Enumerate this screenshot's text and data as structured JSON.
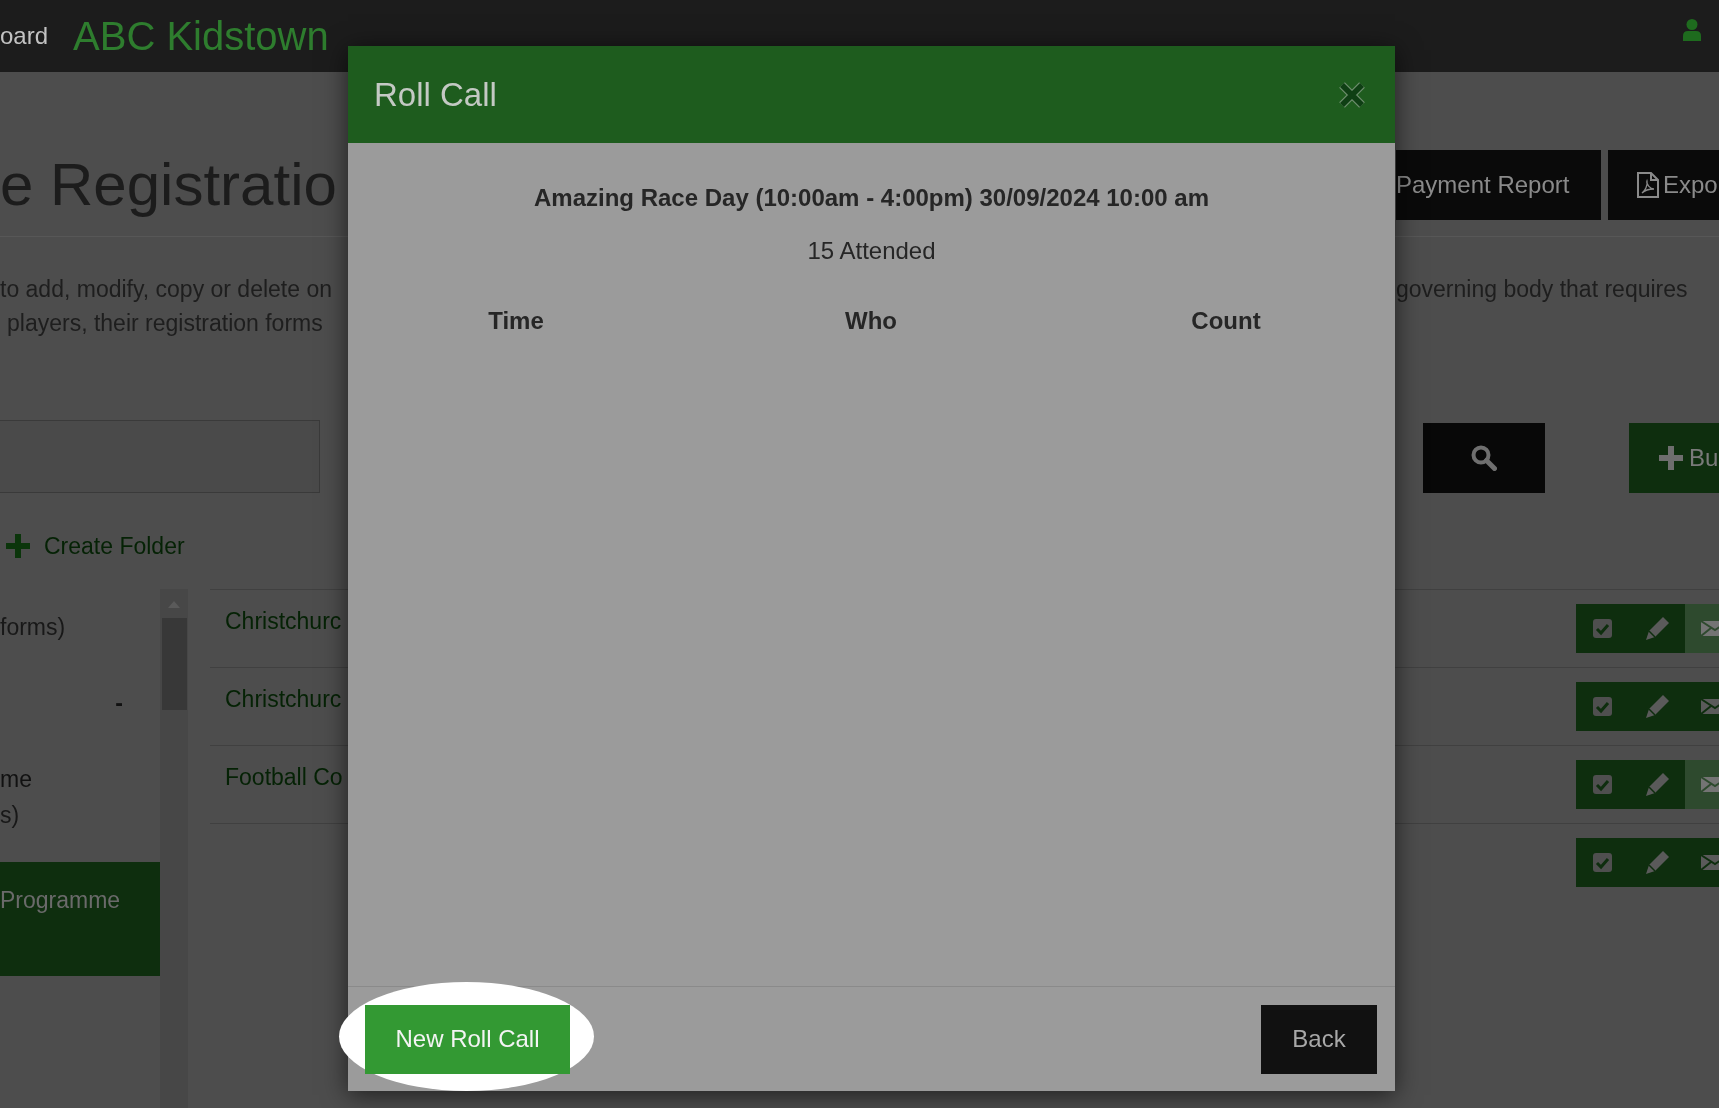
{
  "top_bar": {
    "nav_link": "oard",
    "brand": "ABC Kidstown"
  },
  "page": {
    "title": "e Registratio",
    "header_buttons": [
      {
        "label": "Payment Report",
        "kind": "report"
      },
      {
        "label": "Expo",
        "kind": "export"
      }
    ],
    "description": {
      "left_lines": [
        "to add, modify, copy or delete on",
        "players, their registration forms"
      ],
      "right_line": "governing body that requires"
    },
    "add_button": {
      "label": "Bu"
    },
    "create_folder": {
      "label": "Create Folder"
    },
    "folders": [
      {
        "count": "forms)",
        "selected": false
      },
      {
        "suffix": "-",
        "selected": false
      },
      {
        "name": "me",
        "count": "s)",
        "selected": false
      },
      {
        "name": "Programme",
        "selected": true
      }
    ],
    "forms": [
      {
        "name": "Christchurc",
        "email_disabled": true
      },
      {
        "name": "Christchurc",
        "email_disabled": false
      },
      {
        "name": "Football Co",
        "email_disabled": true
      },
      {
        "email_disabled": false
      }
    ]
  },
  "modal": {
    "title": "Roll Call",
    "event": "Amazing Race Day (10:00am - 4:00pm) 30/09/2024 10:00 am",
    "attendance": "15 Attended",
    "columns": [
      "Time",
      "Who",
      "Count"
    ],
    "buttons": [
      {
        "label": "New Roll Call",
        "kind": "primary",
        "highlighted": true
      },
      {
        "label": "Back",
        "kind": "secondary",
        "highlighted": false
      }
    ]
  }
}
